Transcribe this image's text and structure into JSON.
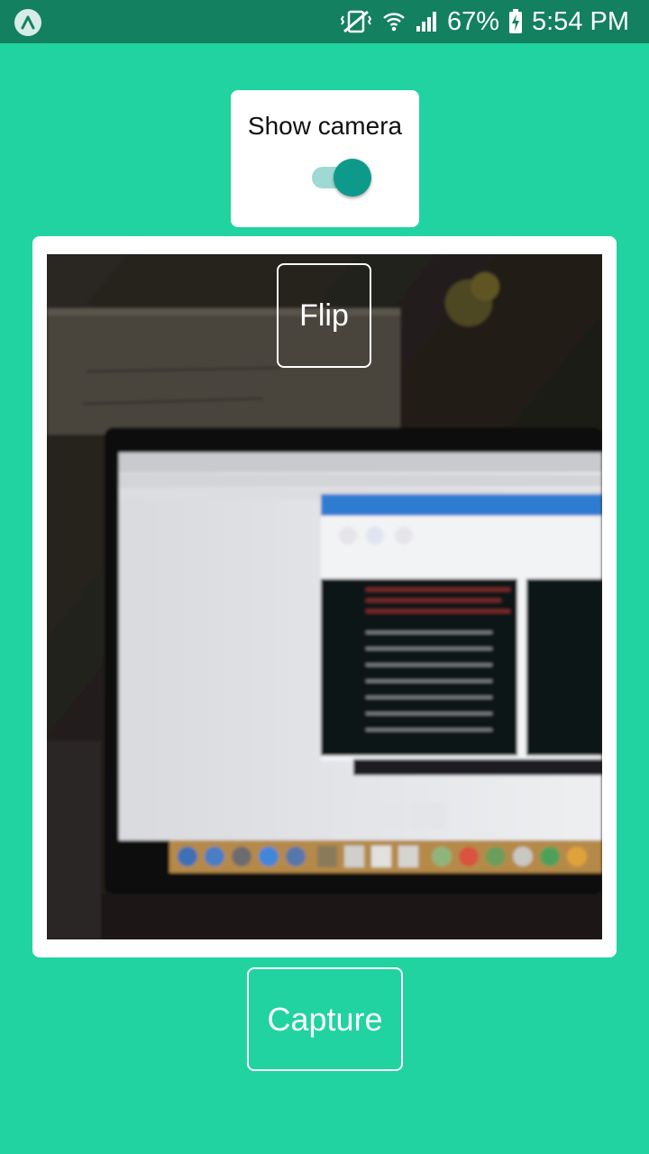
{
  "status_bar": {
    "battery_percent": "67%",
    "time": "5:54 PM",
    "icons": [
      "expo-app-icon",
      "mute-vibrate-icon",
      "wifi-icon",
      "cellular-signal-icon",
      "battery-charging-icon"
    ],
    "colors": {
      "bar": "#13805f",
      "text": "#ffffff"
    }
  },
  "toggle": {
    "label": "Show camera",
    "checked": true,
    "colors": {
      "track": "#9fd9d3",
      "thumb": "#0e9a8a"
    }
  },
  "camera": {
    "flip_label": "Flip"
  },
  "capture": {
    "label": "Capture"
  },
  "theme": {
    "background": "#20d3a1",
    "card": "#ffffff"
  }
}
